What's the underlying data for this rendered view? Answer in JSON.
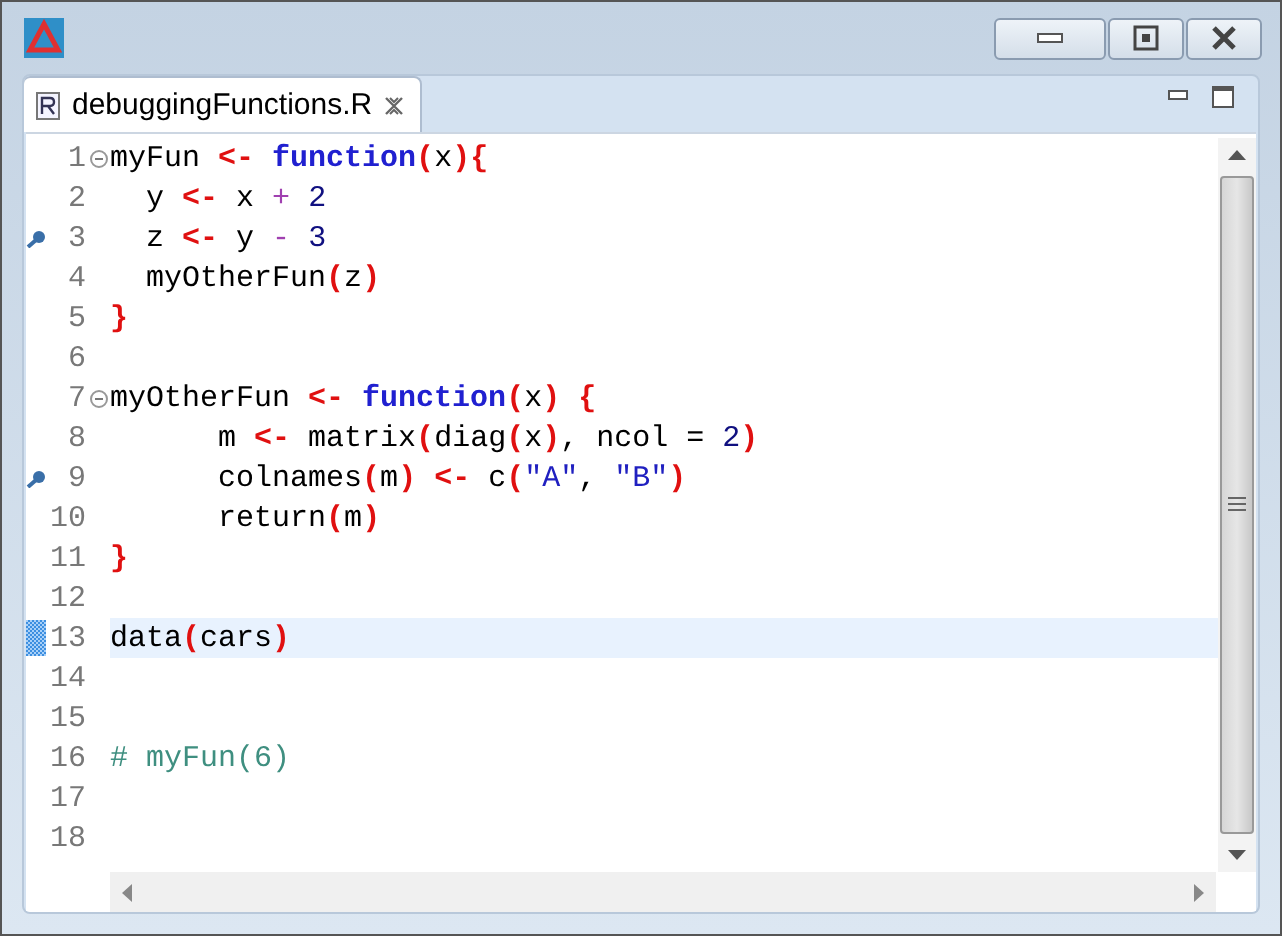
{
  "tab": {
    "label": "debuggingFunctions.R",
    "selected": true
  },
  "lines": [
    {
      "number": "1",
      "fold": true,
      "breakpoint": false,
      "current": false,
      "tokens": [
        {
          "kind": "plain",
          "text": "myFun "
        },
        {
          "kind": "op",
          "text": "<- "
        },
        {
          "kind": "keyword",
          "text": "function"
        },
        {
          "kind": "op",
          "text": "("
        },
        {
          "kind": "plain",
          "text": "x"
        },
        {
          "kind": "op",
          "text": "){"
        }
      ]
    },
    {
      "number": "2",
      "fold": false,
      "breakpoint": false,
      "current": false,
      "tokens": [
        {
          "kind": "plain",
          "text": "  y "
        },
        {
          "kind": "op",
          "text": "<-"
        },
        {
          "kind": "plain",
          "text": " x "
        },
        {
          "kind": "arith",
          "text": "+ "
        },
        {
          "kind": "number",
          "text": "2"
        }
      ]
    },
    {
      "number": "3",
      "fold": false,
      "breakpoint": true,
      "current": false,
      "tokens": [
        {
          "kind": "plain",
          "text": "  z "
        },
        {
          "kind": "op",
          "text": "<-"
        },
        {
          "kind": "plain",
          "text": " y "
        },
        {
          "kind": "arith",
          "text": "- "
        },
        {
          "kind": "number",
          "text": "3"
        }
      ]
    },
    {
      "number": "4",
      "fold": false,
      "breakpoint": false,
      "current": false,
      "tokens": [
        {
          "kind": "plain",
          "text": "  myOtherFun"
        },
        {
          "kind": "op",
          "text": "("
        },
        {
          "kind": "plain",
          "text": "z"
        },
        {
          "kind": "op",
          "text": ")"
        }
      ]
    },
    {
      "number": "5",
      "fold": false,
      "breakpoint": false,
      "current": false,
      "tokens": [
        {
          "kind": "op",
          "text": "}"
        }
      ]
    },
    {
      "number": "6",
      "fold": false,
      "breakpoint": false,
      "current": false
    },
    {
      "number": "7",
      "fold": true,
      "breakpoint": false,
      "current": false,
      "tokens": [
        {
          "kind": "plain",
          "text": "myOtherFun "
        },
        {
          "kind": "op",
          "text": "<- "
        },
        {
          "kind": "keyword",
          "text": "function"
        },
        {
          "kind": "op",
          "text": "("
        },
        {
          "kind": "plain",
          "text": "x"
        },
        {
          "kind": "op",
          "text": ") {"
        }
      ]
    },
    {
      "number": "8",
      "fold": false,
      "breakpoint": false,
      "current": false,
      "tokens": [
        {
          "kind": "plain",
          "text": "      m "
        },
        {
          "kind": "op",
          "text": "<-"
        },
        {
          "kind": "plain",
          "text": " matrix"
        },
        {
          "kind": "op",
          "text": "("
        },
        {
          "kind": "plain",
          "text": "diag"
        },
        {
          "kind": "op",
          "text": "("
        },
        {
          "kind": "plain",
          "text": "x"
        },
        {
          "kind": "op",
          "text": ")"
        },
        {
          "kind": "plain",
          "text": ", ncol = "
        },
        {
          "kind": "number",
          "text": "2"
        },
        {
          "kind": "op",
          "text": ")"
        }
      ]
    },
    {
      "number": "9",
      "fold": false,
      "breakpoint": true,
      "current": false,
      "tokens": [
        {
          "kind": "plain",
          "text": "      colnames"
        },
        {
          "kind": "op",
          "text": "("
        },
        {
          "kind": "plain",
          "text": "m"
        },
        {
          "kind": "op",
          "text": ") <-"
        },
        {
          "kind": "plain",
          "text": " c"
        },
        {
          "kind": "op",
          "text": "("
        },
        {
          "kind": "string",
          "text": "\"A\""
        },
        {
          "kind": "plain",
          "text": ", "
        },
        {
          "kind": "string",
          "text": "\"B\""
        },
        {
          "kind": "op",
          "text": ")"
        }
      ]
    },
    {
      "number": "10",
      "fold": false,
      "breakpoint": false,
      "current": false,
      "tokens": [
        {
          "kind": "plain",
          "text": "      return"
        },
        {
          "kind": "op",
          "text": "("
        },
        {
          "kind": "plain",
          "text": "m"
        },
        {
          "kind": "op",
          "text": ")"
        }
      ]
    },
    {
      "number": "11",
      "fold": false,
      "breakpoint": false,
      "current": false,
      "tokens": [
        {
          "kind": "op",
          "text": "}"
        }
      ]
    },
    {
      "number": "12",
      "fold": false,
      "breakpoint": false,
      "current": false
    },
    {
      "number": "13",
      "fold": false,
      "breakpoint": false,
      "current": true,
      "tokens": [
        {
          "kind": "plain",
          "text": "data"
        },
        {
          "kind": "op",
          "text": "("
        },
        {
          "kind": "plain",
          "text": "cars"
        },
        {
          "kind": "op",
          "text": ")"
        }
      ]
    },
    {
      "number": "14",
      "fold": false,
      "breakpoint": false,
      "current": false
    },
    {
      "number": "15",
      "fold": false,
      "breakpoint": false,
      "current": false
    },
    {
      "number": "16",
      "fold": false,
      "breakpoint": false,
      "current": false,
      "tokens": [
        {
          "kind": "comment",
          "text": "# myFun(6)"
        }
      ]
    },
    {
      "number": "17",
      "fold": false,
      "breakpoint": false,
      "current": false
    },
    {
      "number": "18",
      "fold": false,
      "breakpoint": false,
      "current": false
    }
  ]
}
